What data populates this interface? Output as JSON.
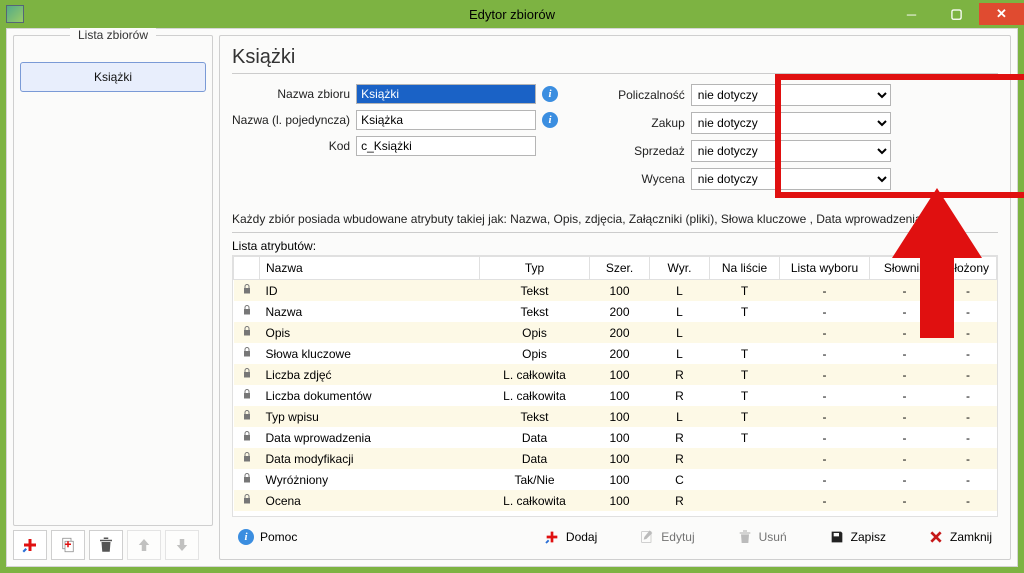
{
  "window": {
    "title": "Edytor zbiorów"
  },
  "sidebar": {
    "group_title": "Lista zbiorów",
    "items": [
      "Książki"
    ]
  },
  "main": {
    "heading": "Książki",
    "labels": {
      "nazwa_zbioru": "Nazwa zbioru",
      "nazwa_poj": "Nazwa (l. pojedyncza)",
      "kod": "Kod",
      "policzalnosc": "Policzalność",
      "zakup": "Zakup",
      "sprzedaz": "Sprzedaż",
      "wycena": "Wycena"
    },
    "values": {
      "nazwa_zbioru": "Książki",
      "nazwa_poj": "Książka",
      "kod": "c_Książki"
    },
    "combo_default": "nie dotyczy",
    "note": "Każdy zbiór posiada wbudowane atrybuty takiej jak: Nazwa, Opis, zdjęcia, Załączniki (pliki), Słowa kluczowe , Data wprowadzenia itp.",
    "list_title": "Lista atrybutów:",
    "columns": [
      "Nazwa",
      "Typ",
      "Szer.",
      "Wyr.",
      "Na liście",
      "Lista wyboru",
      "Słownik",
      "Złożony"
    ],
    "rows": [
      {
        "n": "ID",
        "t": "Tekst",
        "s": "100",
        "w": "L",
        "o": "T",
        "lw": "-",
        "sl": "-",
        "z": "-"
      },
      {
        "n": "Nazwa",
        "t": "Tekst",
        "s": "200",
        "w": "L",
        "o": "T",
        "lw": "-",
        "sl": "-",
        "z": "-"
      },
      {
        "n": "Opis",
        "t": "Opis",
        "s": "200",
        "w": "L",
        "o": "",
        "lw": "-",
        "sl": "-",
        "z": "-"
      },
      {
        "n": "Słowa kluczowe",
        "t": "Opis",
        "s": "200",
        "w": "L",
        "o": "T",
        "lw": "-",
        "sl": "-",
        "z": "-"
      },
      {
        "n": "Liczba zdjęć",
        "t": "L. całkowita",
        "s": "100",
        "w": "R",
        "o": "T",
        "lw": "-",
        "sl": "-",
        "z": "-"
      },
      {
        "n": "Liczba dokumentów",
        "t": "L. całkowita",
        "s": "100",
        "w": "R",
        "o": "T",
        "lw": "-",
        "sl": "-",
        "z": "-"
      },
      {
        "n": "Typ wpisu",
        "t": "Tekst",
        "s": "100",
        "w": "L",
        "o": "T",
        "lw": "-",
        "sl": "-",
        "z": "-"
      },
      {
        "n": "Data wprowadzenia",
        "t": "Data",
        "s": "100",
        "w": "R",
        "o": "T",
        "lw": "-",
        "sl": "-",
        "z": "-"
      },
      {
        "n": "Data modyfikacji",
        "t": "Data",
        "s": "100",
        "w": "R",
        "o": "",
        "lw": "-",
        "sl": "-",
        "z": "-"
      },
      {
        "n": "Wyróżniony",
        "t": "Tak/Nie",
        "s": "100",
        "w": "C",
        "o": "",
        "lw": "-",
        "sl": "-",
        "z": "-"
      },
      {
        "n": "Ocena",
        "t": "L. całkowita",
        "s": "100",
        "w": "R",
        "o": "",
        "lw": "-",
        "sl": "-",
        "z": "-"
      }
    ]
  },
  "footer": {
    "pomoc": "Pomoc",
    "dodaj": "Dodaj",
    "edytuj": "Edytuj",
    "usun": "Usuń",
    "zapisz": "Zapisz",
    "zamknij": "Zamknij"
  }
}
